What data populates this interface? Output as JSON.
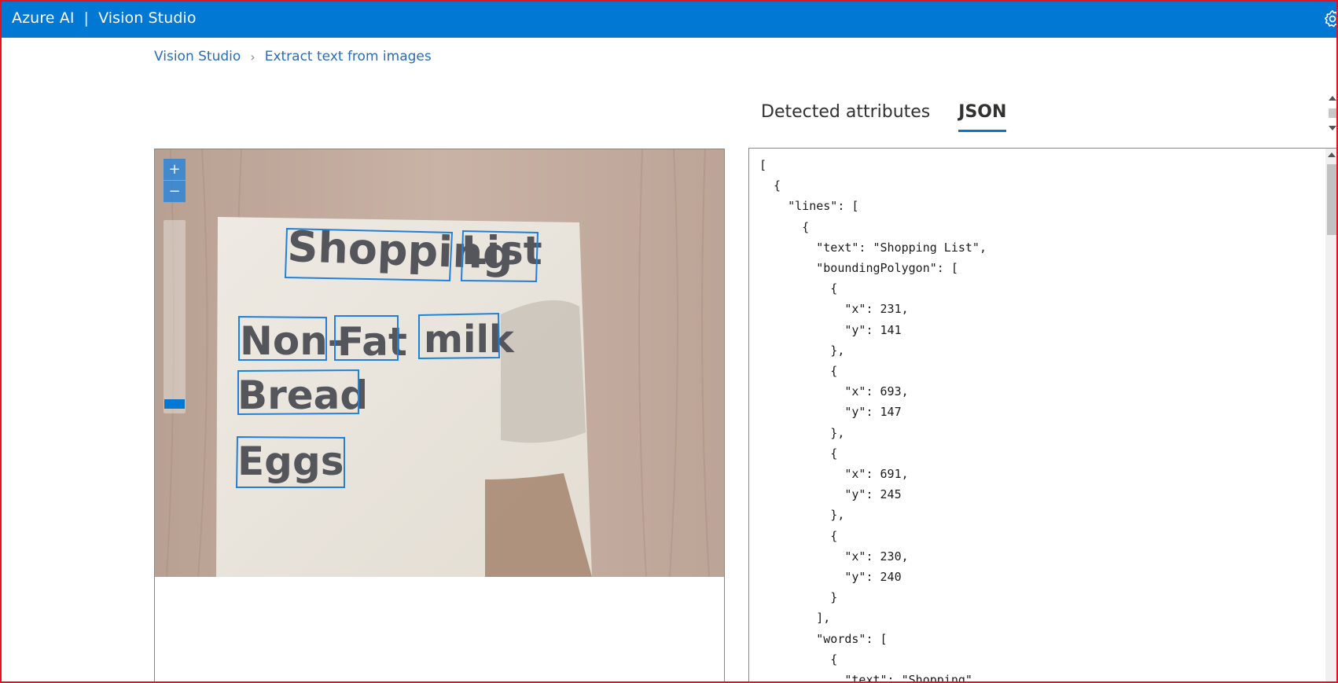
{
  "header": {
    "brand": "Azure AI",
    "separator": "|",
    "product": "Vision Studio"
  },
  "breadcrumb": {
    "home": "Vision Studio",
    "current": "Extract text from images"
  },
  "tabs": [
    {
      "label": "Detected attributes",
      "active": false
    },
    {
      "label": "JSON",
      "active": true
    }
  ],
  "zoom": {
    "in_label": "+",
    "out_label": "−",
    "level": 0.05
  },
  "image": {
    "words": [
      "Shopping",
      "List",
      "Non-",
      "Fat",
      "milk",
      "Bread",
      "Eggs"
    ]
  },
  "json_output": "[\n  {\n    \"lines\": [\n      {\n        \"text\": \"Shopping List\",\n        \"boundingPolygon\": [\n          {\n            \"x\": 231,\n            \"y\": 141\n          },\n          {\n            \"x\": 693,\n            \"y\": 147\n          },\n          {\n            \"x\": 691,\n            \"y\": 245\n          },\n          {\n            \"x\": 230,\n            \"y\": 240\n          }\n        ],\n        \"words\": [\n          {\n            \"text\": \"Shopping\",",
  "colors": {
    "accent": "#0078d4",
    "frame": "#e81123",
    "link": "#2b6cb8"
  }
}
